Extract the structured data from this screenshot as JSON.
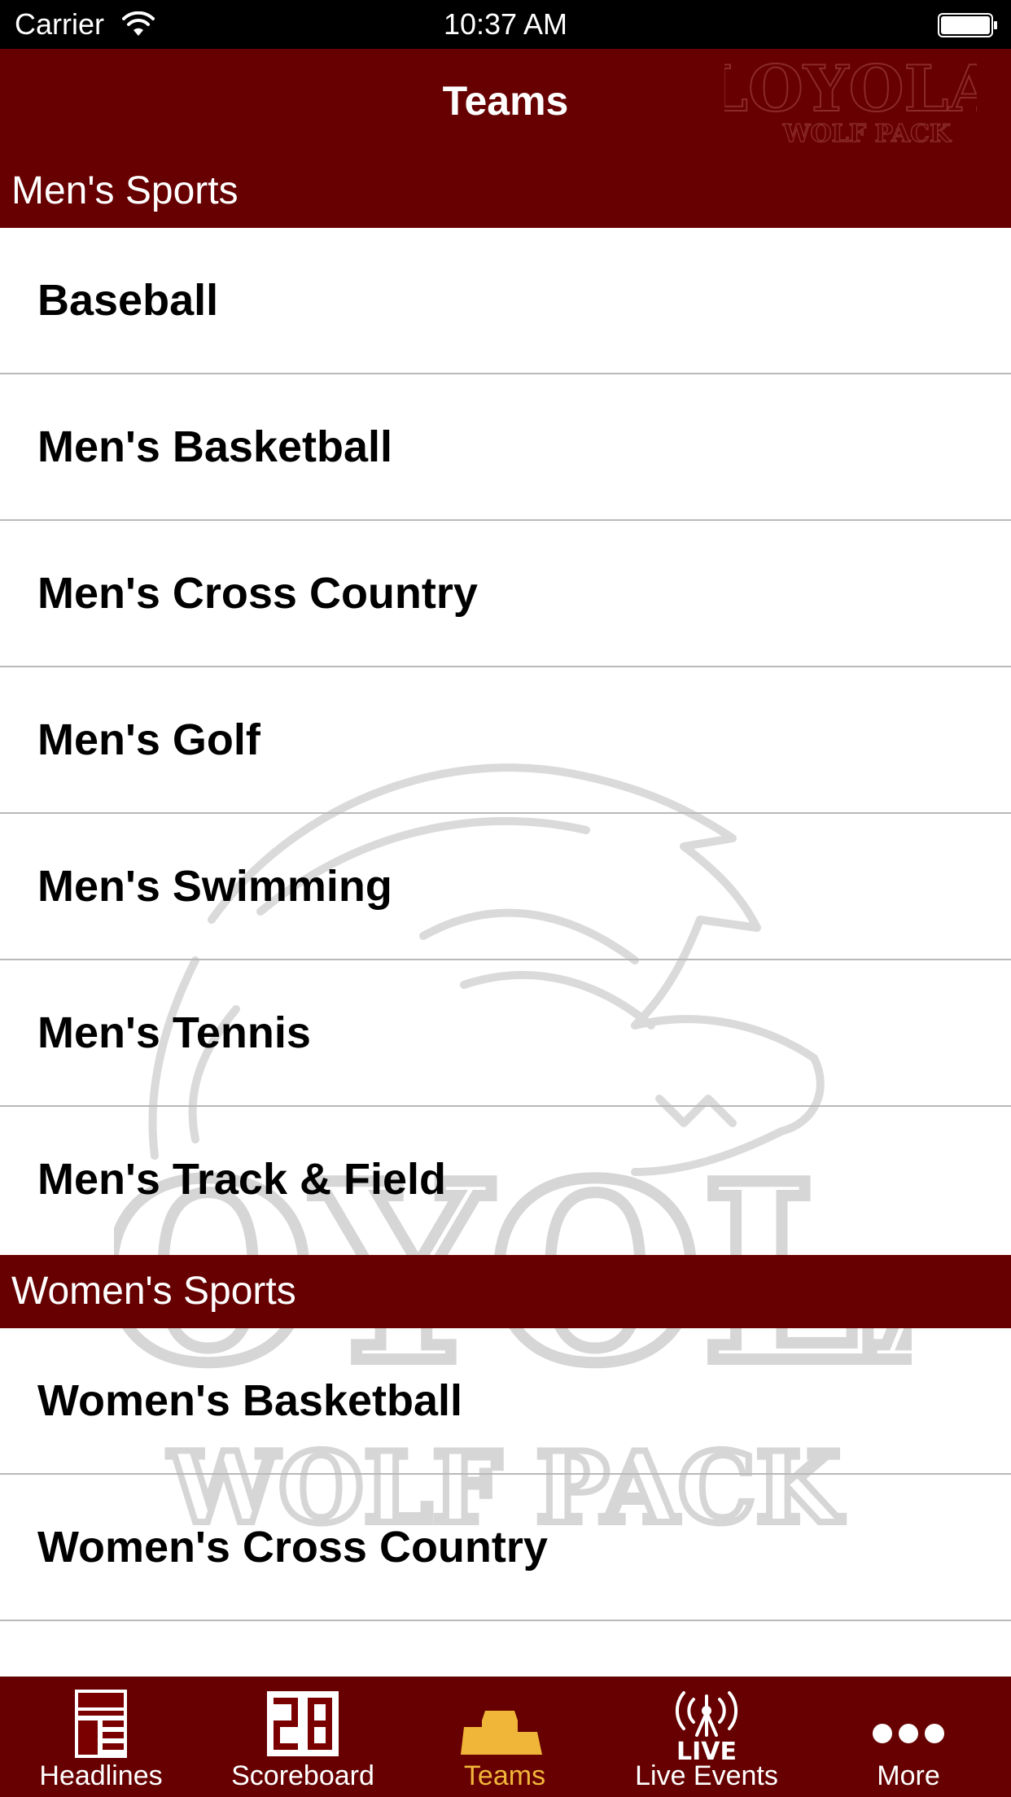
{
  "status_bar": {
    "carrier": "Carrier",
    "time": "10:37 AM"
  },
  "nav": {
    "title": "Teams"
  },
  "sections": [
    {
      "title": "Men's Sports",
      "items": [
        "Baseball",
        "Men's Basketball",
        "Men's Cross Country",
        "Men's Golf",
        "Men's Swimming",
        "Men's Tennis",
        "Men's Track & Field"
      ]
    },
    {
      "title": "Women's Sports",
      "items": [
        "Women's Basketball",
        "Women's Cross Country"
      ]
    }
  ],
  "tabs": [
    {
      "label": "Headlines",
      "icon": "news-icon"
    },
    {
      "label": "Scoreboard",
      "icon": "scoreboard-icon"
    },
    {
      "label": "Teams",
      "icon": "podium-icon",
      "active": true
    },
    {
      "label": "Live Events",
      "icon": "live-icon"
    },
    {
      "label": "More",
      "icon": "more-icon"
    }
  ],
  "branding": {
    "logo_text": "LOYOLA",
    "logo_subtext": "WOLF PACK"
  },
  "colors": {
    "brand": "#670000",
    "active_tab": "#f0b63a",
    "separator": "#b9b9b9"
  }
}
